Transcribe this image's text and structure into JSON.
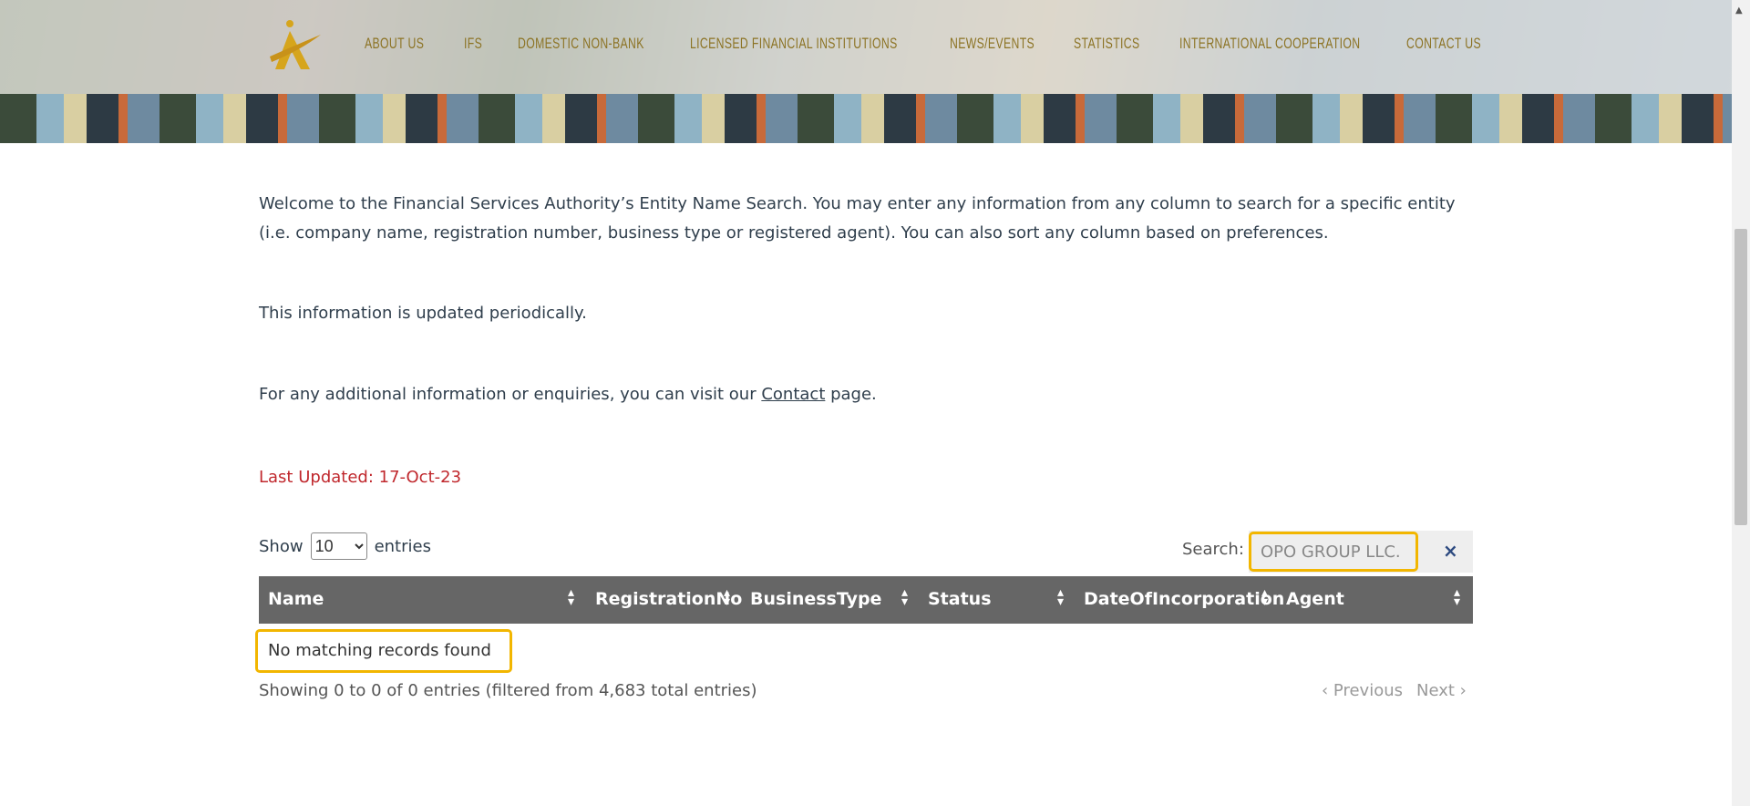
{
  "nav": {
    "items": [
      "ABOUT US",
      "IFS",
      "DOMESTIC NON-BANK",
      "LICENSED FINANCIAL INSTITUTIONS",
      "NEWS/EVENTS",
      "STATISTICS",
      "INTERNATIONAL COOPERATION",
      "CONTACT US"
    ]
  },
  "intro": {
    "p1": "Welcome to the Financial Services Authority’s Entity Name Search. You may enter any information from any column to search for a specific entity (i.e. company name, registration number, business type or registered agent). You can also sort any column based on preferences.",
    "p2": "This information is updated periodically.",
    "p3_before": "For any additional information or enquiries, you can visit our ",
    "p3_link": "Contact",
    "p3_after": " page.",
    "last_updated": "Last Updated:  17-Oct-23"
  },
  "table_controls": {
    "show_label": "Show",
    "entries_value": "10",
    "entries_label": "entries",
    "search_label": "Search:",
    "search_value": "OPO GROUP LLC.",
    "clear": "×"
  },
  "table": {
    "columns": [
      "Name",
      "RegistrationNo",
      "BusinessType",
      "Status",
      "DateOfIncorporation",
      "Agent"
    ],
    "empty_message": "No matching records found"
  },
  "footer": {
    "info": "Showing 0 to 0 of 0 entries (filtered from 4,683 total entries)",
    "previous": "Previous",
    "next": "Next"
  },
  "colors": {
    "nav": "#8c7324",
    "header": "#666666",
    "highlight": "#f2b600",
    "updated": "#c0282d"
  }
}
